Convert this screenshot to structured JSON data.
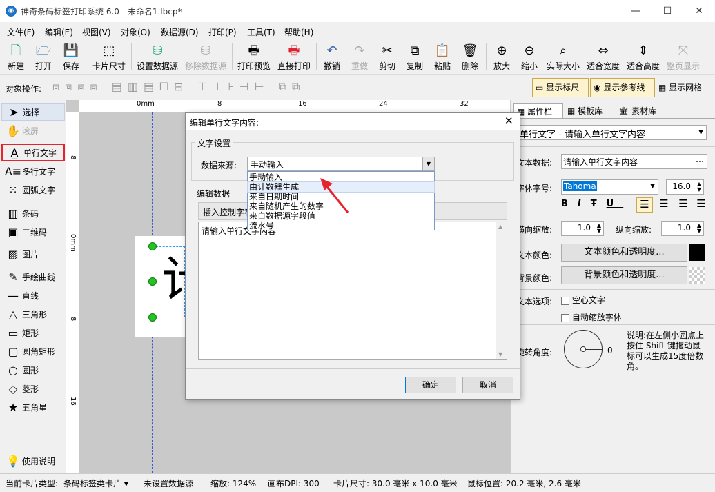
{
  "window": {
    "title": "神奇条码标签打印系统 6.0 - 未命名1.lbcp*",
    "minimize": "—",
    "maximize": "☐",
    "close": "✕"
  },
  "menu": [
    "文件(F)",
    "编辑(E)",
    "视图(V)",
    "对象(O)",
    "数据源(D)",
    "打印(P)",
    "工具(T)",
    "帮助(H)"
  ],
  "toolbar": [
    "新建",
    "打开",
    "保存",
    "卡片尺寸",
    "设置数据源",
    "移除数据源",
    "打印预览",
    "直接打印",
    "撤销",
    "重做",
    "剪切",
    "复制",
    "粘贴",
    "删除",
    "放大",
    "缩小",
    "实际大小",
    "适合宽度",
    "适合高度",
    "整页显示"
  ],
  "toolbar2": {
    "label": "对象操作:",
    "show_ruler": "显示标尺",
    "show_guides": "显示参考线",
    "show_grid": "显示网格"
  },
  "tools": [
    "选择",
    "滚屏",
    "单行文字",
    "多行文字",
    "圆弧文字",
    "条码",
    "二维码",
    "图片",
    "手绘曲线",
    "直线",
    "三角形",
    "矩形",
    "圆角矩形",
    "圆形",
    "菱形",
    "五角星",
    "使用说明"
  ],
  "ruler": {
    "top": [
      "0mm",
      "8",
      "16",
      "24",
      "32"
    ],
    "left": [
      "8",
      "0mm",
      "8",
      "16"
    ]
  },
  "canvas": {
    "sample_char": "计"
  },
  "dialog": {
    "title": "编辑单行文字内容:",
    "section_text": "文字设置",
    "source_label": "数据来源:",
    "source_value": "手动输入",
    "dropdown_options": [
      "手动输入",
      "由计数器生成",
      "来自日期时间",
      "来自随机产生的数字",
      "来自数据源字段值",
      "流水号"
    ],
    "section_edit": "编辑数据",
    "insert_button": "插入控制字符",
    "text_value": "请输入单行文字内容",
    "ok": "确定",
    "cancel": "取消"
  },
  "rightpanel": {
    "tabs": [
      "属性栏",
      "模板库",
      "素材库"
    ],
    "object_select": "单行文字 - 请输入单行文字内容",
    "text_data_label": "文本数据:",
    "text_data_value": "请输入单行文字内容",
    "font_label": "字体字号:",
    "font_name": "Tahoma",
    "font_size": "16.0",
    "hscale_label": "横向缩放:",
    "hscale": "1.0",
    "vscale_label": "纵向缩放:",
    "vscale": "1.0",
    "text_color_label": "文本颜色:",
    "text_color_button": "文本颜色和透明度...",
    "bg_color_label": "背景颜色:",
    "bg_color_button": "背景颜色和透明度...",
    "options_label": "文本选项:",
    "hollow": "空心文字",
    "autoshrink": "自动缩放字体",
    "rotation_label": "旋转角度:",
    "rotation_value": "0",
    "rotation_note": "说明:在左侧小圆点上按住 Shift 键拖动鼠标可以生成15度倍数角。"
  },
  "status": {
    "card_type_label": "当前卡片类型:",
    "card_type": "条码标签类卡片",
    "datasource": "未设置数据源",
    "zoom": "缩放: 124%",
    "dpi": "画布DPI: 300",
    "card_size": "卡片尺寸: 30.0 毫米 x 10.0 毫米",
    "mouse": "鼠标位置: 20.2 毫米, 2.6 毫米"
  },
  "colors": {
    "accent": "#1a73c8",
    "highlight": "#e5242b",
    "handle": "#22c522",
    "selection": "#3399ff"
  }
}
